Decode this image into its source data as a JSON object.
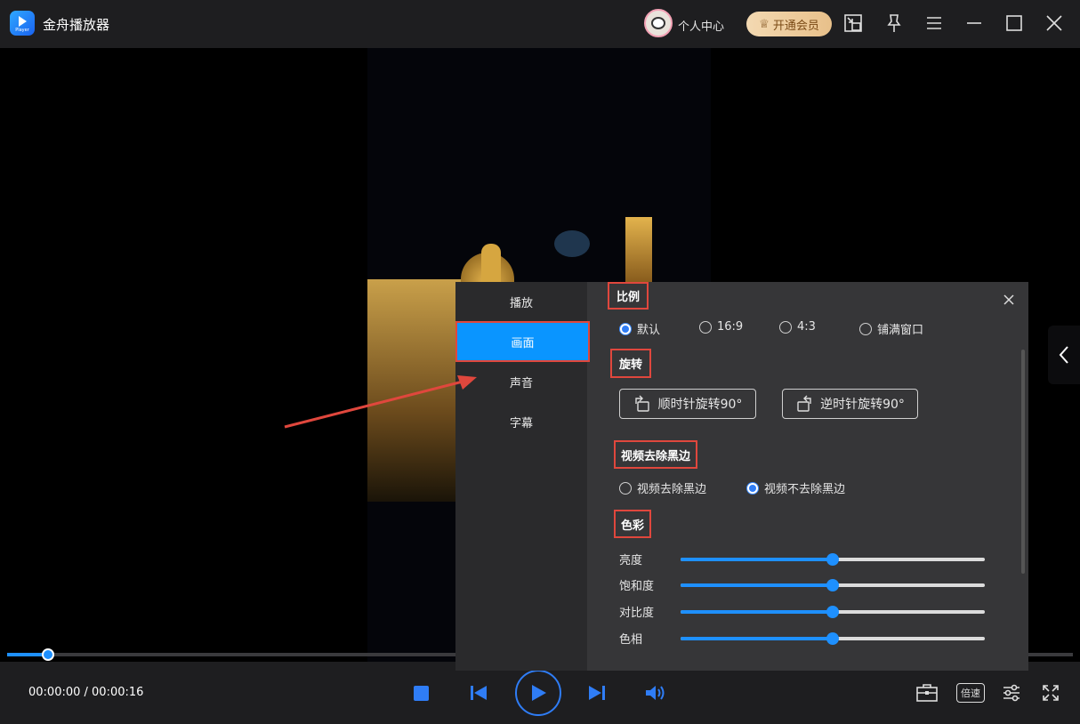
{
  "titlebar": {
    "logo_text": "Player",
    "app_title": "金舟播放器",
    "user_center": "个人中心",
    "vip_label": "开通会员"
  },
  "progress": {
    "fraction": 0.038
  },
  "controls": {
    "time": "00:00:00 / 00:00:16",
    "speed_label": "倍速"
  },
  "settings": {
    "nav": [
      "播放",
      "画面",
      "声音",
      "字幕"
    ],
    "active_nav": "画面",
    "ratio": {
      "title": "比例",
      "options": [
        "默认",
        "16:9",
        "4:3",
        "铺满窗口"
      ],
      "selected": "默认"
    },
    "rotation": {
      "title": "旋转",
      "clockwise": "顺时针旋转90°",
      "counter_clockwise": "逆时针旋转90°"
    },
    "black_border": {
      "title": "视频去除黑边",
      "options": [
        "视频去除黑边",
        "视频不去除黑边"
      ],
      "selected": "视频不去除黑边"
    },
    "color": {
      "title": "色彩",
      "sliders": [
        {
          "label": "亮度",
          "value": 0.5
        },
        {
          "label": "饱和度",
          "value": 0.5
        },
        {
          "label": "对比度",
          "value": 0.5
        },
        {
          "label": "色相",
          "value": 0.5
        }
      ]
    }
  },
  "colors": {
    "accent": "#1e90ff",
    "annotation": "#e0473d",
    "panel": "#363638"
  }
}
